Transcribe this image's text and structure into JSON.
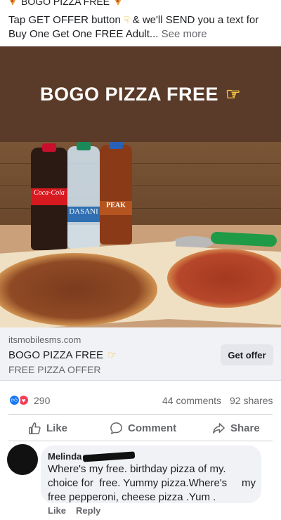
{
  "post": {
    "caption_top": "BOGO PIZZA FREE",
    "caption_line1_a": "Tap GET OFFER button",
    "caption_line1_b": "& we'll SEND you a text for",
    "caption_line2": "Buy One Get One FREE Adult...",
    "see_more": "See more",
    "icons": [
      "pizza-icon",
      "point-down-icon",
      "point-right-icon"
    ]
  },
  "banner": {
    "title": "BOGO PIZZA FREE",
    "background": "#5a3a28",
    "text_color": "#ffffff"
  },
  "photo": {
    "bottle_coke": "Coca-Cola",
    "bottle_water": "DASANI",
    "bottle_tea": "PEAK"
  },
  "link_card": {
    "domain": "itsmobilesms.com",
    "headline": "BOGO PIZZA FREE",
    "subtitle": "FREE PIZZA OFFER",
    "button_label": "Get offer"
  },
  "stats": {
    "reactions": "290",
    "comments": "44 comments",
    "shares": "92 shares"
  },
  "actions": {
    "like": "Like",
    "comment": "Comment",
    "share": "Share"
  },
  "comment": {
    "author": "Melinda",
    "lines": [
      "Where's my free. birthday pizza of my.",
      "choice for  free. Yummy pizza.Where's     my",
      "free pepperoni, cheese pizza .Yum ."
    ],
    "like": "Like",
    "reply": "Reply"
  },
  "colors": {
    "accent": "#1877f2",
    "love": "#f33e58",
    "muted": "#65676b"
  }
}
